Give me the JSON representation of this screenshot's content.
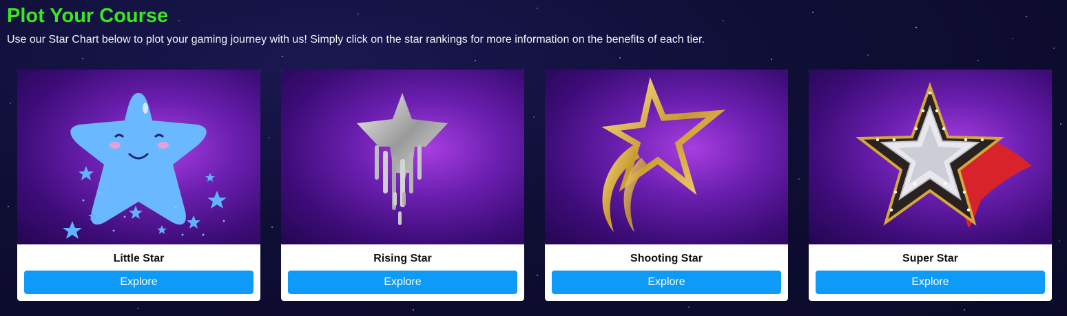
{
  "header": {
    "title": "Plot Your Course",
    "subtitle": "Use our Star Chart below to plot your gaming journey with us! Simply click on the star rankings for more information on the benefits of each tier."
  },
  "colors": {
    "title": "#39e81f",
    "button": "#0e9af7",
    "background": "#0f0e35"
  },
  "cards": [
    {
      "title": "Little Star",
      "button_label": "Explore",
      "icon": "little-star-icon"
    },
    {
      "title": "Rising Star",
      "button_label": "Explore",
      "icon": "rising-star-icon"
    },
    {
      "title": "Shooting Star",
      "button_label": "Explore",
      "icon": "shooting-star-icon"
    },
    {
      "title": "Super Star",
      "button_label": "Explore",
      "icon": "super-star-icon"
    }
  ]
}
